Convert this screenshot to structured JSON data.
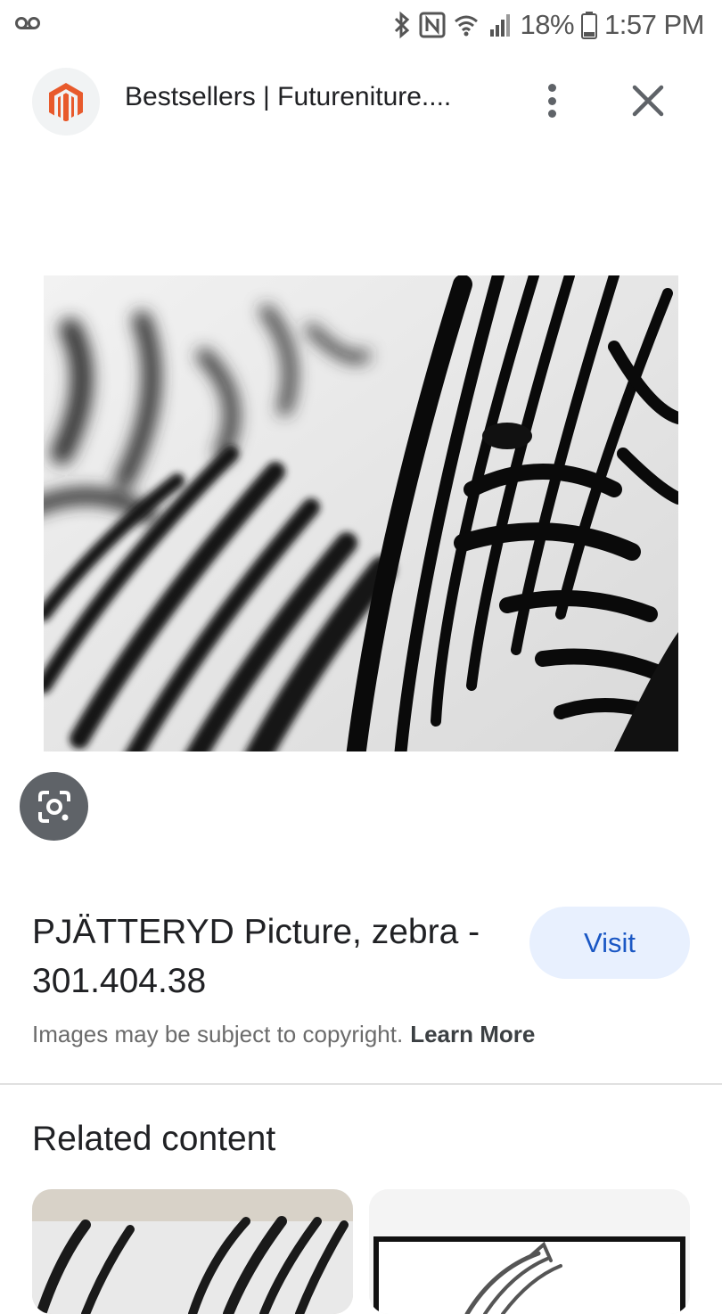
{
  "status_bar": {
    "battery": "18%",
    "time": "1:57 PM",
    "icons": [
      "voicemail-icon",
      "bluetooth-icon",
      "nfc-icon",
      "wifi-icon",
      "signal-icon",
      "battery-icon"
    ]
  },
  "header": {
    "title": "Bestsellers | Futureniture....",
    "favicon": "magento-logo",
    "favicon_color": "#e85a2c"
  },
  "image": {
    "subject": "zebra-photo"
  },
  "product": {
    "title": "PJÄTTERYD Picture, zebra - 301.404.38",
    "visit_label": "Visit",
    "copyright_text": "Images may be subject to copyright.",
    "learn_more": "Learn More"
  },
  "related": {
    "title": "Related content"
  },
  "colors": {
    "visit_bg": "#e8f0fe",
    "visit_text": "#1a57c4",
    "lens_bg": "#5f6368"
  }
}
